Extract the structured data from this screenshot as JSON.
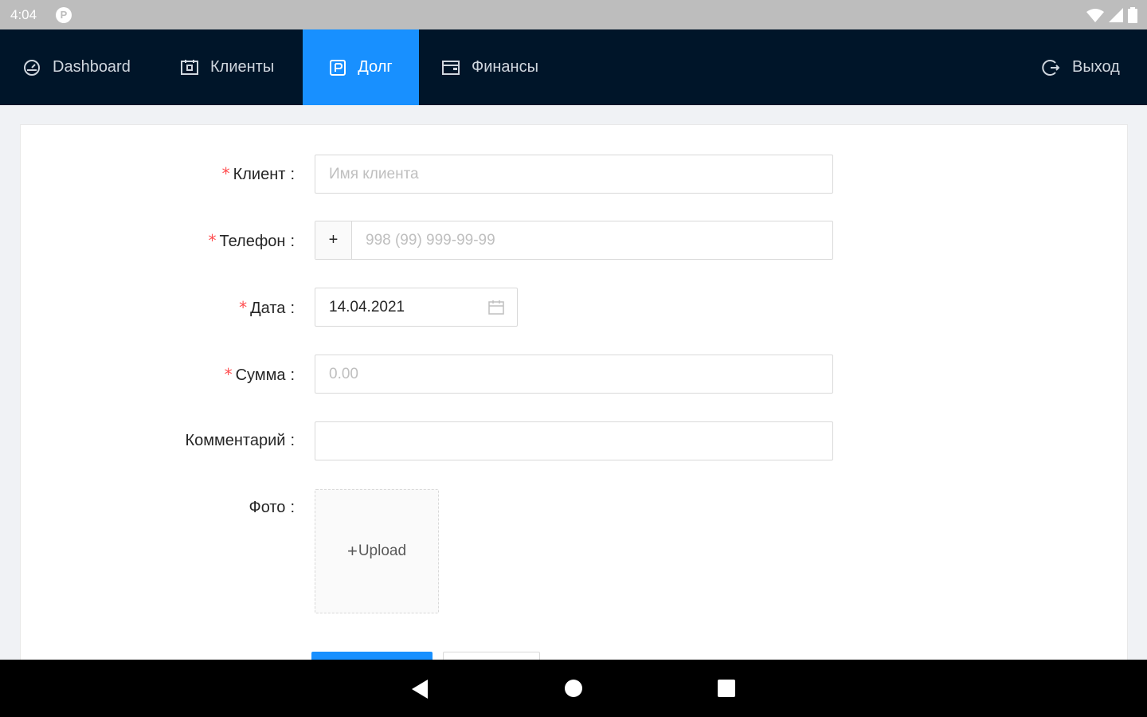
{
  "status_bar": {
    "time": "4:04",
    "app_icon_letter": "P"
  },
  "nav": {
    "items": [
      {
        "label": "Dashboard",
        "icon": "dashboard-icon"
      },
      {
        "label": "Клиенты",
        "icon": "calendar-contacts-icon"
      },
      {
        "label": "Долг",
        "icon": "debt-icon",
        "active": true
      },
      {
        "label": "Финансы",
        "icon": "wallet-icon"
      }
    ],
    "logout_label": "Выход",
    "active_color": "#1890ff",
    "background_color": "#001529"
  },
  "form": {
    "client": {
      "label": "Клиент",
      "placeholder": "Имя клиента",
      "required": true
    },
    "phone": {
      "label": "Телефон",
      "prefix": "+",
      "placeholder": "998 (99) 999-99-99",
      "required": true
    },
    "date": {
      "label": "Дата",
      "value": "14.04.2021",
      "required": true
    },
    "amount": {
      "label": "Сумма",
      "placeholder": "0.00",
      "required": true
    },
    "comment": {
      "label": "Комментарий",
      "value": ""
    },
    "photo": {
      "label": "Фото",
      "upload_label": "Upload",
      "upload_plus": "+"
    },
    "required_mark": "*",
    "colon": ":"
  }
}
